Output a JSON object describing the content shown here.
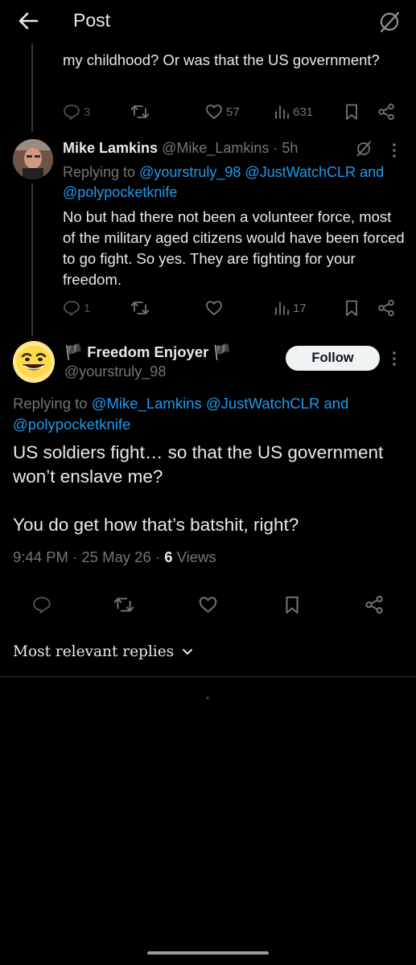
{
  "header": {
    "title": "Post",
    "back_icon": "arrow-left-icon",
    "grok_icon": "grok-icon"
  },
  "previous_post": {
    "text": "my childhood? Or was that the US government?",
    "actions": {
      "replies": "3",
      "reposts": "",
      "likes": "57",
      "views": "631"
    }
  },
  "reply": {
    "name": "Mike Lamkins",
    "handle": "@Mike_Lamkins",
    "time": "5h",
    "replying_prefix": "Replying to",
    "mentions": [
      "@yourstruly_98",
      "@JustWatchCLR",
      "@polypocketknife"
    ],
    "and": "and",
    "text": "No but had there not been a volunteer force, most of the military aged citizens would have been forced to go fight. So yes. They are fighting for your freedom.",
    "actions": {
      "replies": "1",
      "reposts": "",
      "likes": "",
      "views": "17"
    }
  },
  "main_post": {
    "name": "Freedom Enjoyer",
    "flag_left": "🏴",
    "flag_right": "🏴",
    "handle": "@yourstruly_98",
    "follow_label": "Follow",
    "replying_prefix": "Replying to",
    "mentions": [
      "@Mike_Lamkins",
      "@JustWatchCLR",
      "@polypocketknife"
    ],
    "and": "and",
    "paragraph_1": "US soldiers fight… so that the US government won’t enslave me?",
    "paragraph_2": "You do get how that’s batshit, right?",
    "time": "9:44 PM",
    "date": "25 May 26",
    "views_count": "6",
    "views_label": "Views"
  },
  "sort": {
    "label": "Most relevant replies",
    "icon": "chevron-down-icon"
  },
  "colors": {
    "background": "#000000",
    "text": "#e7e9ea",
    "muted": "#71767b",
    "link": "#1d9bf0",
    "divider": "#2f3336"
  }
}
